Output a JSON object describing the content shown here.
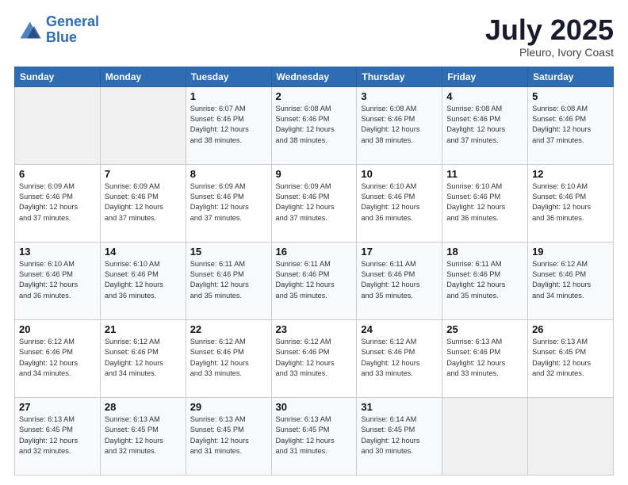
{
  "header": {
    "logo_line1": "General",
    "logo_line2": "Blue",
    "month": "July 2025",
    "location": "Pleuro, Ivory Coast"
  },
  "weekdays": [
    "Sunday",
    "Monday",
    "Tuesday",
    "Wednesday",
    "Thursday",
    "Friday",
    "Saturday"
  ],
  "weeks": [
    [
      {
        "day": "",
        "info": ""
      },
      {
        "day": "",
        "info": ""
      },
      {
        "day": "1",
        "info": "Sunrise: 6:07 AM\nSunset: 6:46 PM\nDaylight: 12 hours\nand 38 minutes."
      },
      {
        "day": "2",
        "info": "Sunrise: 6:08 AM\nSunset: 6:46 PM\nDaylight: 12 hours\nand 38 minutes."
      },
      {
        "day": "3",
        "info": "Sunrise: 6:08 AM\nSunset: 6:46 PM\nDaylight: 12 hours\nand 38 minutes."
      },
      {
        "day": "4",
        "info": "Sunrise: 6:08 AM\nSunset: 6:46 PM\nDaylight: 12 hours\nand 37 minutes."
      },
      {
        "day": "5",
        "info": "Sunrise: 6:08 AM\nSunset: 6:46 PM\nDaylight: 12 hours\nand 37 minutes."
      }
    ],
    [
      {
        "day": "6",
        "info": "Sunrise: 6:09 AM\nSunset: 6:46 PM\nDaylight: 12 hours\nand 37 minutes."
      },
      {
        "day": "7",
        "info": "Sunrise: 6:09 AM\nSunset: 6:46 PM\nDaylight: 12 hours\nand 37 minutes."
      },
      {
        "day": "8",
        "info": "Sunrise: 6:09 AM\nSunset: 6:46 PM\nDaylight: 12 hours\nand 37 minutes."
      },
      {
        "day": "9",
        "info": "Sunrise: 6:09 AM\nSunset: 6:46 PM\nDaylight: 12 hours\nand 37 minutes."
      },
      {
        "day": "10",
        "info": "Sunrise: 6:10 AM\nSunset: 6:46 PM\nDaylight: 12 hours\nand 36 minutes."
      },
      {
        "day": "11",
        "info": "Sunrise: 6:10 AM\nSunset: 6:46 PM\nDaylight: 12 hours\nand 36 minutes."
      },
      {
        "day": "12",
        "info": "Sunrise: 6:10 AM\nSunset: 6:46 PM\nDaylight: 12 hours\nand 36 minutes."
      }
    ],
    [
      {
        "day": "13",
        "info": "Sunrise: 6:10 AM\nSunset: 6:46 PM\nDaylight: 12 hours\nand 36 minutes."
      },
      {
        "day": "14",
        "info": "Sunrise: 6:10 AM\nSunset: 6:46 PM\nDaylight: 12 hours\nand 36 minutes."
      },
      {
        "day": "15",
        "info": "Sunrise: 6:11 AM\nSunset: 6:46 PM\nDaylight: 12 hours\nand 35 minutes."
      },
      {
        "day": "16",
        "info": "Sunrise: 6:11 AM\nSunset: 6:46 PM\nDaylight: 12 hours\nand 35 minutes."
      },
      {
        "day": "17",
        "info": "Sunrise: 6:11 AM\nSunset: 6:46 PM\nDaylight: 12 hours\nand 35 minutes."
      },
      {
        "day": "18",
        "info": "Sunrise: 6:11 AM\nSunset: 6:46 PM\nDaylight: 12 hours\nand 35 minutes."
      },
      {
        "day": "19",
        "info": "Sunrise: 6:12 AM\nSunset: 6:46 PM\nDaylight: 12 hours\nand 34 minutes."
      }
    ],
    [
      {
        "day": "20",
        "info": "Sunrise: 6:12 AM\nSunset: 6:46 PM\nDaylight: 12 hours\nand 34 minutes."
      },
      {
        "day": "21",
        "info": "Sunrise: 6:12 AM\nSunset: 6:46 PM\nDaylight: 12 hours\nand 34 minutes."
      },
      {
        "day": "22",
        "info": "Sunrise: 6:12 AM\nSunset: 6:46 PM\nDaylight: 12 hours\nand 33 minutes."
      },
      {
        "day": "23",
        "info": "Sunrise: 6:12 AM\nSunset: 6:46 PM\nDaylight: 12 hours\nand 33 minutes."
      },
      {
        "day": "24",
        "info": "Sunrise: 6:12 AM\nSunset: 6:46 PM\nDaylight: 12 hours\nand 33 minutes."
      },
      {
        "day": "25",
        "info": "Sunrise: 6:13 AM\nSunset: 6:46 PM\nDaylight: 12 hours\nand 33 minutes."
      },
      {
        "day": "26",
        "info": "Sunrise: 6:13 AM\nSunset: 6:45 PM\nDaylight: 12 hours\nand 32 minutes."
      }
    ],
    [
      {
        "day": "27",
        "info": "Sunrise: 6:13 AM\nSunset: 6:45 PM\nDaylight: 12 hours\nand 32 minutes."
      },
      {
        "day": "28",
        "info": "Sunrise: 6:13 AM\nSunset: 6:45 PM\nDaylight: 12 hours\nand 32 minutes."
      },
      {
        "day": "29",
        "info": "Sunrise: 6:13 AM\nSunset: 6:45 PM\nDaylight: 12 hours\nand 31 minutes."
      },
      {
        "day": "30",
        "info": "Sunrise: 6:13 AM\nSunset: 6:45 PM\nDaylight: 12 hours\nand 31 minutes."
      },
      {
        "day": "31",
        "info": "Sunrise: 6:14 AM\nSunset: 6:45 PM\nDaylight: 12 hours\nand 30 minutes."
      },
      {
        "day": "",
        "info": ""
      },
      {
        "day": "",
        "info": ""
      }
    ]
  ]
}
